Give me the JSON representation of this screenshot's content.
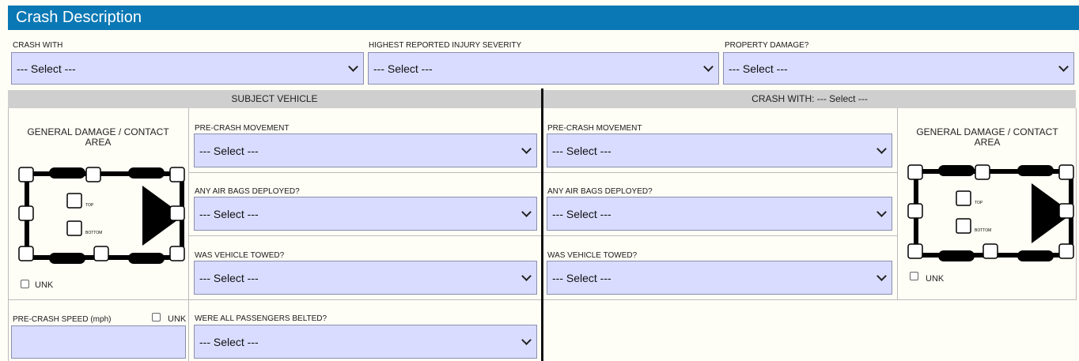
{
  "header": {
    "title": "Crash Description"
  },
  "top_fields": [
    {
      "label": "CRASH WITH",
      "value": "--- Select ---"
    },
    {
      "label": "HIGHEST REPORTED INJURY SEVERITY",
      "value": "--- Select ---"
    },
    {
      "label": "PROPERTY DAMAGE?",
      "value": "--- Select ---"
    }
  ],
  "bands": {
    "subject": "SUBJECT VEHICLE",
    "other": "CRASH WITH: --- Select ---"
  },
  "damage": {
    "title": "GENERAL DAMAGE / CONTACT AREA",
    "top": "TOP",
    "bottom": "BOTTOM",
    "unk": "UNK"
  },
  "subject": {
    "pre_crash_movement": {
      "label": "PRE-CRASH MOVEMENT",
      "value": "--- Select ---"
    },
    "air_bags": {
      "label": "ANY AIR BAGS DEPLOYED?",
      "value": "--- Select ---"
    },
    "towed": {
      "label": "WAS VEHICLE TOWED?",
      "value": "--- Select ---"
    },
    "belted": {
      "label": "WERE ALL PASSENGERS BELTED?",
      "value": "--- Select ---"
    },
    "speed": {
      "label": "PRE-CRASH SPEED (mph)",
      "unk": "UNK",
      "value": ""
    }
  },
  "other": {
    "pre_crash_movement": {
      "label": "PRE-CRASH MOVEMENT",
      "value": "--- Select ---"
    },
    "air_bags": {
      "label": "ANY AIR BAGS DEPLOYED?",
      "value": "--- Select ---"
    },
    "towed": {
      "label": "WAS VEHICLE TOWED?",
      "value": "--- Select ---"
    }
  }
}
